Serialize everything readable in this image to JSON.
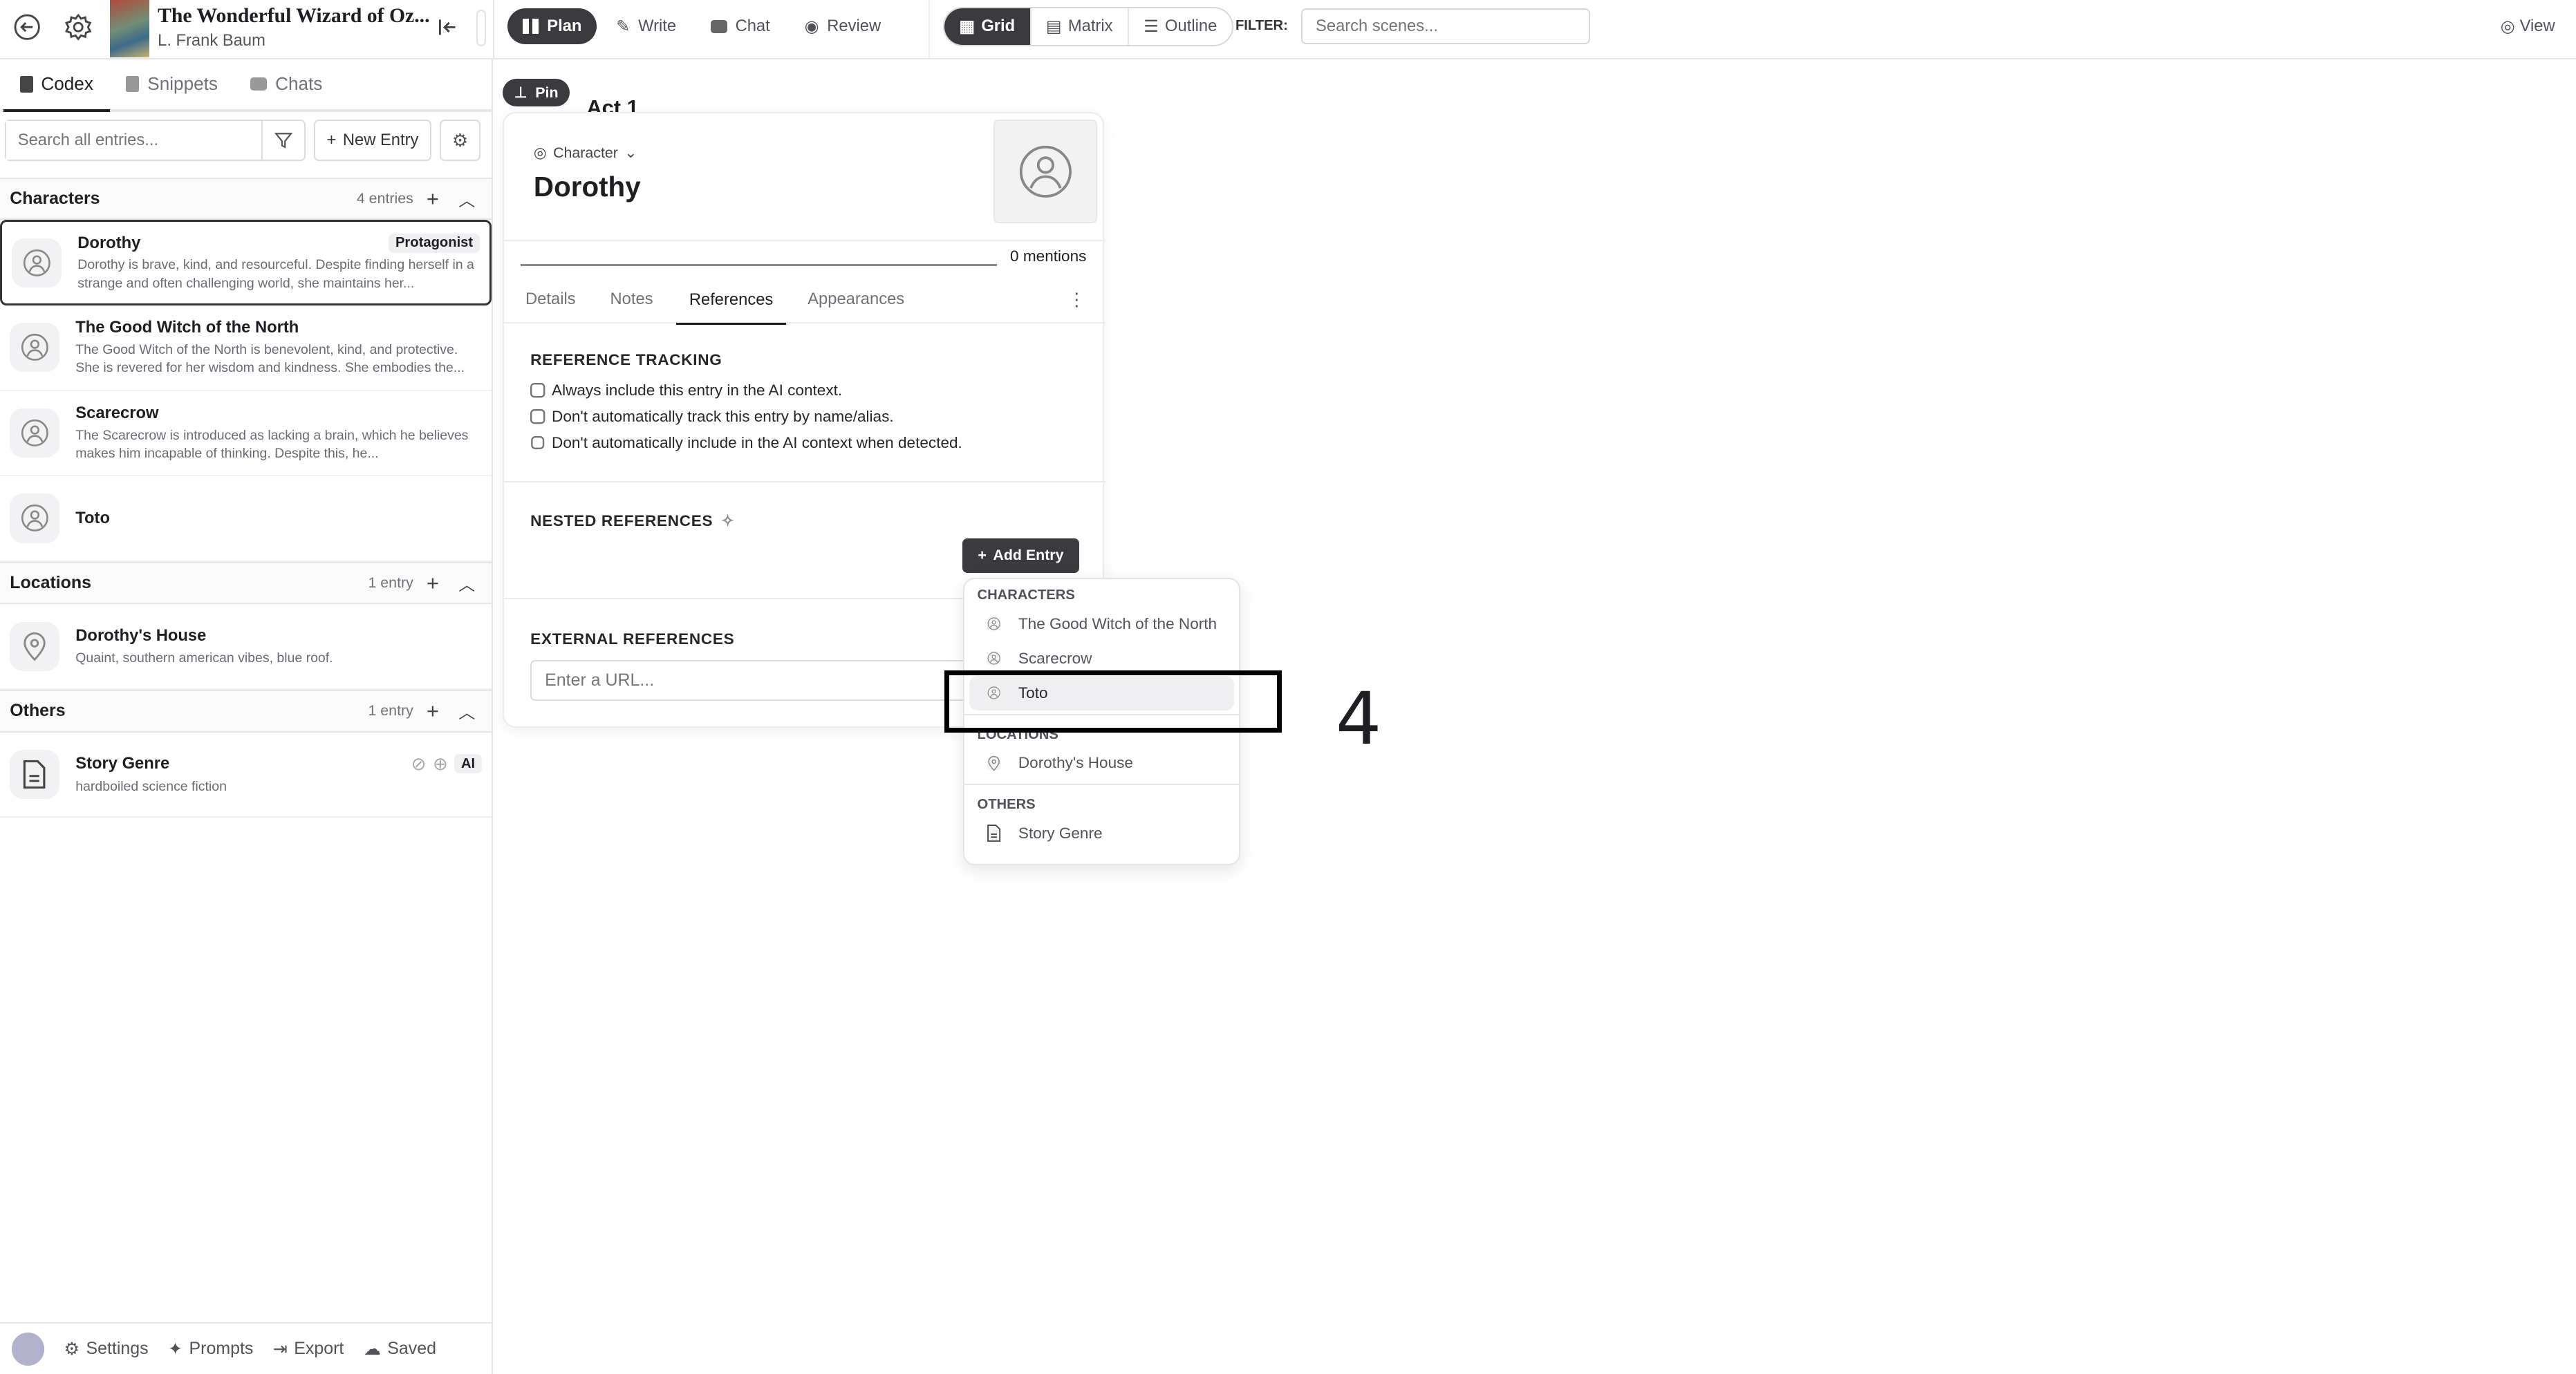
{
  "header": {
    "book_title": "The Wonderful Wizard of Oz...",
    "author": "L. Frank Baum",
    "modes": [
      {
        "label": "Plan",
        "icon": "columns-icon",
        "active": true
      },
      {
        "label": "Write",
        "icon": "pen-icon"
      },
      {
        "label": "Chat",
        "icon": "chat-icon"
      },
      {
        "label": "Review",
        "icon": "eye-icon"
      }
    ],
    "views": [
      {
        "label": "Grid",
        "active": true
      },
      {
        "label": "Matrix"
      },
      {
        "label": "Outline"
      }
    ],
    "filter_label": "FILTER:",
    "filter_placeholder": "Search scenes...",
    "view_label": "View"
  },
  "sidebar": {
    "tabs": [
      {
        "label": "Codex",
        "active": true
      },
      {
        "label": "Snippets"
      },
      {
        "label": "Chats"
      }
    ],
    "search_placeholder": "Search all entries...",
    "new_entry_label": "New Entry",
    "sections": [
      {
        "title": "Characters",
        "count": "4 entries",
        "entries": [
          {
            "name": "Dorothy",
            "badge": "Protagonist",
            "desc": "Dorothy is brave, kind, and resourceful. Despite finding herself in a strange and often challenging world, she maintains her...",
            "selected": true
          },
          {
            "name": "The Good Witch of the North",
            "desc": "The Good Witch of the North is benevolent, kind, and protective. She is revered for her wisdom and kindness. She embodies the..."
          },
          {
            "name": "Scarecrow",
            "desc": "The Scarecrow is introduced as lacking a brain, which he believes makes him incapable of thinking. Despite this, he..."
          },
          {
            "name": "Toto",
            "desc": ""
          }
        ]
      },
      {
        "title": "Locations",
        "count": "1 entry",
        "entries": [
          {
            "name": "Dorothy's House",
            "desc": "Quaint, southern american vibes, blue roof."
          }
        ]
      },
      {
        "title": "Others",
        "count": "1 entry",
        "entries": [
          {
            "name": "Story Genre",
            "desc": "hardboiled science fiction",
            "tag": "AI"
          }
        ]
      }
    ],
    "footer": {
      "settings": "Settings",
      "prompts": "Prompts",
      "export": "Export",
      "saved": "Saved"
    }
  },
  "main": {
    "pin_label": "Pin",
    "act_title": "Act 1"
  },
  "card": {
    "type_label": "Character",
    "name": "Dorothy",
    "mentions": "0 mentions",
    "tabs": [
      {
        "label": "Details"
      },
      {
        "label": "Notes"
      },
      {
        "label": "References",
        "active": true
      },
      {
        "label": "Appearances"
      }
    ],
    "reference_tracking": {
      "title": "REFERENCE TRACKING",
      "options": [
        {
          "label": "Always include this entry in the AI context.",
          "checked": false
        },
        {
          "label": "Don't automatically track this entry by name/alias.",
          "checked": false
        },
        {
          "label": "Don't automatically include in the AI context when detected.",
          "checked": false
        }
      ]
    },
    "nested_title": "NESTED REFERENCES",
    "add_entry_label": "Add Entry",
    "external_title": "EXTERNAL REFERENCES",
    "url_placeholder": "Enter a URL..."
  },
  "dropdown": {
    "groups": [
      {
        "title": "CHARACTERS",
        "items": [
          {
            "label": "The Good Witch of the North"
          },
          {
            "label": "Scarecrow"
          },
          {
            "label": "Toto",
            "highlighted": true
          }
        ]
      },
      {
        "title": "LOCATIONS",
        "items": [
          {
            "label": "Dorothy's House"
          }
        ]
      },
      {
        "title": "OTHERS",
        "items": [
          {
            "label": "Story Genre"
          }
        ]
      }
    ]
  },
  "annotation": {
    "label": "4"
  }
}
